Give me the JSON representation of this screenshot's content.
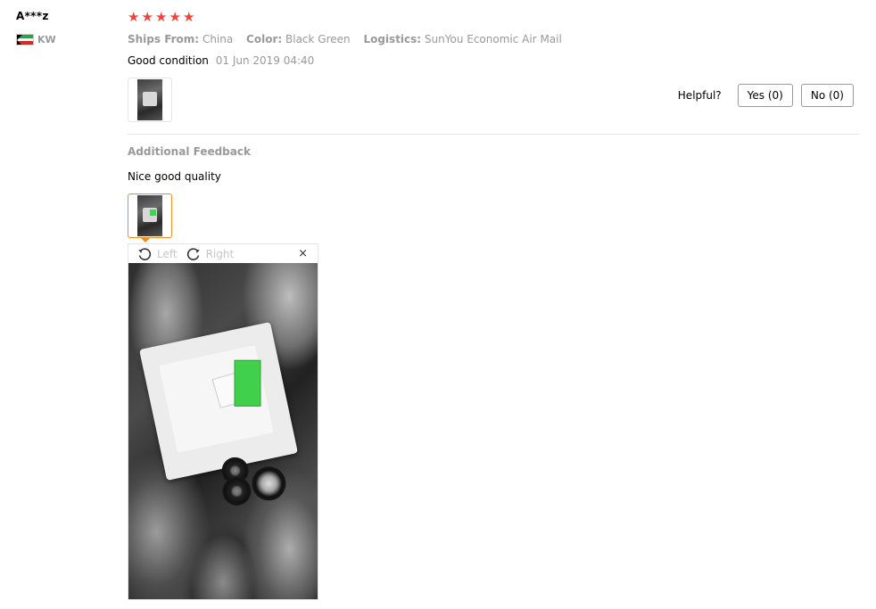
{
  "user": {
    "name": "A***z",
    "country": "KW"
  },
  "rating": {
    "stars": 5,
    "max": 5,
    "star_color": "#f44336"
  },
  "attributes": [
    {
      "label": "Ships From:",
      "value": "China"
    },
    {
      "label": "Color:",
      "value": "Black Green"
    },
    {
      "label": "Logistics:",
      "value": "SunYou Economic Air Mail"
    }
  ],
  "review": {
    "text": "Good condition",
    "date": "01 Jun 2019 04:40"
  },
  "helpful": {
    "label": "Helpful?",
    "yes_label": "Yes (0)",
    "no_label": "No (0)"
  },
  "additional": {
    "title": "Additional Feedback",
    "text": "Nice good quality"
  },
  "viewer": {
    "rotate_left_label": "Left",
    "rotate_right_label": "Right",
    "close_icon": "×"
  },
  "colors": {
    "accent": "#f08b1f",
    "muted": "#999999"
  }
}
